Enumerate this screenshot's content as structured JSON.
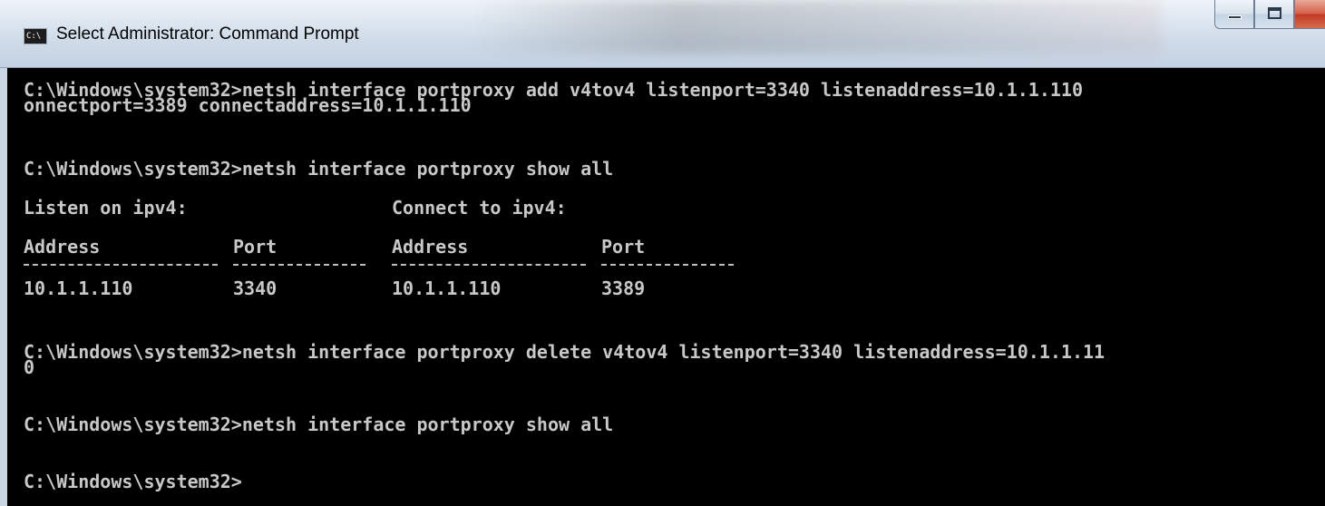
{
  "window": {
    "title": "Select Administrator: Command Prompt",
    "icon_text": "C:\\",
    "icon": "console-icon"
  },
  "caption_buttons": {
    "minimize_icon": "minimize-icon",
    "maximize_icon": "maximize-icon",
    "close_icon": "close-icon"
  },
  "console": {
    "lines": [
      "C:\\Windows\\system32>netsh interface portproxy add v4tov4 listenport=3340 listenaddress=10.1.1.110",
      "onnectport=3389 connectaddress=10.1.1.110",
      "C:\\Windows\\system32>netsh interface portproxy show all",
      "C:\\Windows\\system32>netsh interface portproxy delete v4tov4 listenport=3340 listenaddress=10.1.1.11",
      "0",
      "C:\\Windows\\system32>netsh interface portproxy show all",
      "C:\\Windows\\system32>"
    ],
    "table": {
      "group_listen": "Listen on ipv4:",
      "group_connect": "Connect to ipv4:",
      "headers": [
        "Address",
        "Port",
        "Address",
        "Port"
      ],
      "rows": [
        [
          "10.1.1.110",
          "3340",
          "10.1.1.110",
          "3389"
        ]
      ]
    }
  },
  "colors": {
    "console_bg": "#000000",
    "console_text": "#c8c8c8",
    "close_button": "#c23a22"
  }
}
